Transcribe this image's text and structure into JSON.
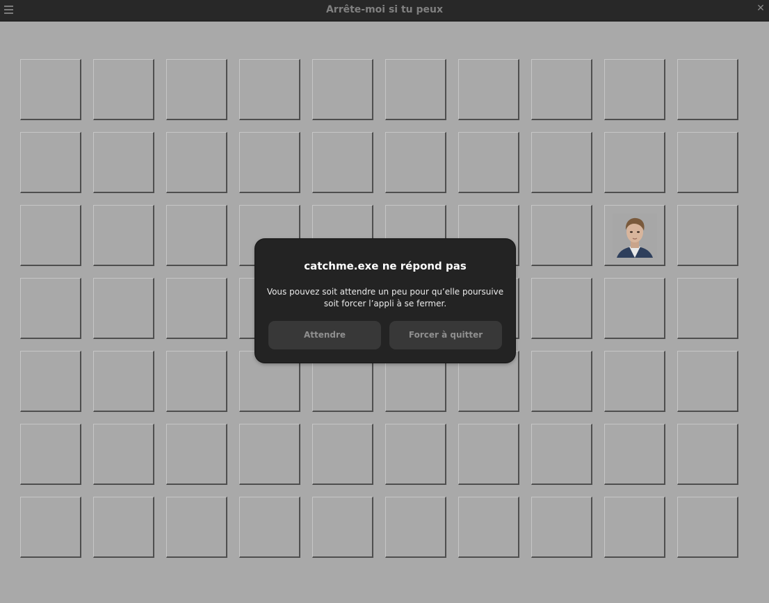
{
  "window": {
    "title": "Arrête-moi si tu peux",
    "menu_icon": "hamburger-menu-icon",
    "close_label": "✕"
  },
  "board": {
    "columns": 10,
    "rows": 7,
    "portrait_cell": {
      "row": 3,
      "column": 9
    }
  },
  "dialog": {
    "title": "catchme.exe ne répond pas",
    "message": "Vous pouvez soit attendre un peu pour qu’elle poursuive soit forcer l’appli à se fermer.",
    "wait_label": "Attendre",
    "force_quit_label": "Forcer à quitter"
  },
  "colors": {
    "board_background": "#a9a9a9",
    "titlebar": "#282828",
    "dialog_background": "#232323",
    "dialog_button": "#383838"
  }
}
